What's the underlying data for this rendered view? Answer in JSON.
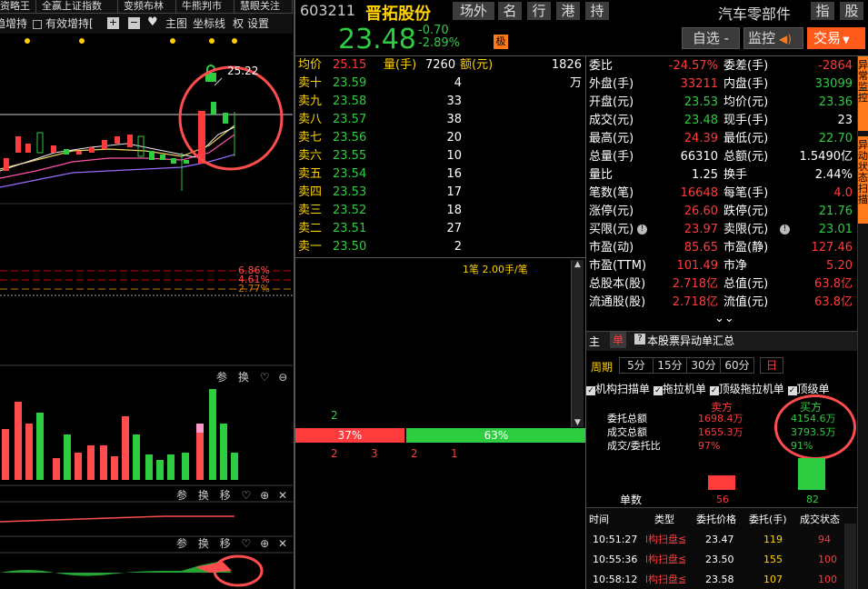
{
  "top_tabs": [
    "资略王",
    "全赢上证指数",
    "变频布林",
    "牛熊判市",
    "慧眼关注"
  ],
  "toolbar": {
    "item1": "趋增持",
    "item2": "有效增持[",
    "add": "+",
    "minus": "−",
    "heart": "♥",
    "main_chart": "主图",
    "coord": "坐标线",
    "quan": "权",
    "settings": "设置"
  },
  "chart": {
    "price_label": "25.22",
    "pct_lines": [
      "6.86%",
      "4.61%",
      "2.77%"
    ]
  },
  "panel_controls": {
    "a": [
      "参",
      "换"
    ],
    "b": [
      "参",
      "换",
      "移"
    ],
    "c": [
      "参",
      "换",
      "移"
    ]
  },
  "stock": {
    "code": "603211",
    "name": "晋拓股份",
    "tags": [
      "场外",
      "名",
      "行",
      "港",
      "持"
    ],
    "sector": "汽车零部件",
    "sector_btns": [
      "指",
      "股"
    ],
    "price": "23.48",
    "change": "-0.70",
    "change_pct": "-2.89%",
    "badge": "极"
  },
  "actions": {
    "select": "自选 -",
    "monitor": "监控",
    "trade": "交易"
  },
  "summary": {
    "avg_label": "均价",
    "avg": "25.15",
    "vol_label": "量(手)",
    "vol": "7260",
    "amt_label": "额(元)",
    "amt": "1826万"
  },
  "asks": [
    {
      "label": "卖十",
      "price": "23.59",
      "vol": "4"
    },
    {
      "label": "卖九",
      "price": "23.58",
      "vol": "33"
    },
    {
      "label": "卖八",
      "price": "23.57",
      "vol": "38"
    },
    {
      "label": "卖七",
      "price": "23.56",
      "vol": "20"
    },
    {
      "label": "卖六",
      "price": "23.55",
      "vol": "10"
    },
    {
      "label": "卖五",
      "price": "23.54",
      "vol": "16"
    },
    {
      "label": "卖四",
      "price": "23.53",
      "vol": "17"
    },
    {
      "label": "卖三",
      "price": "23.52",
      "vol": "18"
    },
    {
      "label": "卖二",
      "price": "23.51",
      "vol": "27"
    },
    {
      "label": "卖一",
      "price": "23.50",
      "vol": "2"
    }
  ],
  "tick_info": "1笔 2.00手/笔",
  "depth": {
    "left_num": "2",
    "sell_pct": "37%",
    "buy_pct": "63%",
    "nums": [
      "2",
      "3",
      "2",
      "1"
    ]
  },
  "quote": [
    {
      "l1": "委比",
      "v1": "-24.57%",
      "c1": "red",
      "l2": "委差(手)",
      "v2": "-2864",
      "c2": "red"
    },
    {
      "l1": "外盘(手)",
      "v1": "33211",
      "c1": "red",
      "l2": "内盘(手)",
      "v2": "33099",
      "c2": "grn"
    },
    {
      "l1": "开盘(元)",
      "v1": "23.53",
      "c1": "grn",
      "l2": "均价(元)",
      "v2": "23.36",
      "c2": "grn"
    },
    {
      "l1": "成交(元)",
      "v1": "23.48",
      "c1": "grn",
      "l2": "现手(手)",
      "v2": "23",
      "c2": "wht"
    },
    {
      "l1": "最高(元)",
      "v1": "24.39",
      "c1": "red",
      "l2": "最低(元)",
      "v2": "22.70",
      "c2": "grn"
    },
    {
      "l1": "总量(手)",
      "v1": "66310",
      "c1": "wht",
      "l2": "总额(元)",
      "v2": "1.5490亿",
      "c2": "wht"
    },
    {
      "l1": "量比",
      "v1": "1.25",
      "c1": "wht",
      "l2": "换手",
      "v2": "2.44%",
      "c2": "wht"
    },
    {
      "l1": "笔数(笔)",
      "v1": "16648",
      "c1": "red",
      "l2": "每笔(手)",
      "v2": "4.0",
      "c2": "red"
    },
    {
      "l1": "涨停(元)",
      "v1": "26.60",
      "c1": "red",
      "l2": "跌停(元)",
      "v2": "21.76",
      "c2": "grn"
    },
    {
      "l1": "买限(元)",
      "v1": "23.97",
      "c1": "red",
      "l2": "卖限(元)",
      "v2": "23.01",
      "c2": "grn"
    },
    {
      "l1": "市盈(动)",
      "v1": "85.65",
      "c1": "red",
      "l2": "市盈(静)",
      "v2": "127.46",
      "c2": "red"
    },
    {
      "l1": "市盈(TTM)",
      "v1": "101.49",
      "c1": "red",
      "l2": "市净",
      "v2": "5.20",
      "c2": "red"
    },
    {
      "l1": "总股本(股)",
      "v1": "2.718亿",
      "c1": "red",
      "l2": "总值(元)",
      "v2": "63.8亿",
      "c2": "red"
    },
    {
      "l1": "流通股(股)",
      "v1": "2.718亿",
      "c1": "red",
      "l2": "流值(元)",
      "v2": "63.8亿",
      "c2": "red"
    }
  ],
  "side_tabs": [
    "异常监控",
    "异动状态扫描"
  ],
  "lower": {
    "tab_main": "主",
    "tab_single": "单",
    "summary_title": "本股票异动单汇总",
    "period_label": "周期",
    "periods": [
      "5分",
      "15分",
      "30分",
      "60分",
      "日"
    ],
    "checks": [
      "机构扫描单",
      "拖拉机单",
      "顶级拖拉机单",
      "顶级单"
    ],
    "seller": "卖方",
    "buyer": "买方",
    "rows": [
      {
        "label": "委托总额",
        "sell": "1698.4万",
        "buy": "4154.6万"
      },
      {
        "label": "成交总额",
        "sell": "1655.3万",
        "buy": "3793.5万"
      },
      {
        "label": "成交/委托比",
        "sell": "97%",
        "buy": "91%"
      }
    ],
    "count_label": "单数",
    "sell_count": "56",
    "buy_count": "82"
  },
  "table": {
    "headers": [
      "时间",
      "类型",
      "委托价格",
      "委托(手)",
      "成交状态"
    ],
    "rows": [
      [
        "10:51:27",
        "l构扫盘≦",
        "23.47",
        "119",
        "94"
      ],
      [
        "10:55:36",
        "l构扫盘≦",
        "23.50",
        "155",
        "100"
      ],
      [
        "10:58:12",
        "l构扫盘≦",
        "23.58",
        "107",
        "100"
      ]
    ]
  }
}
